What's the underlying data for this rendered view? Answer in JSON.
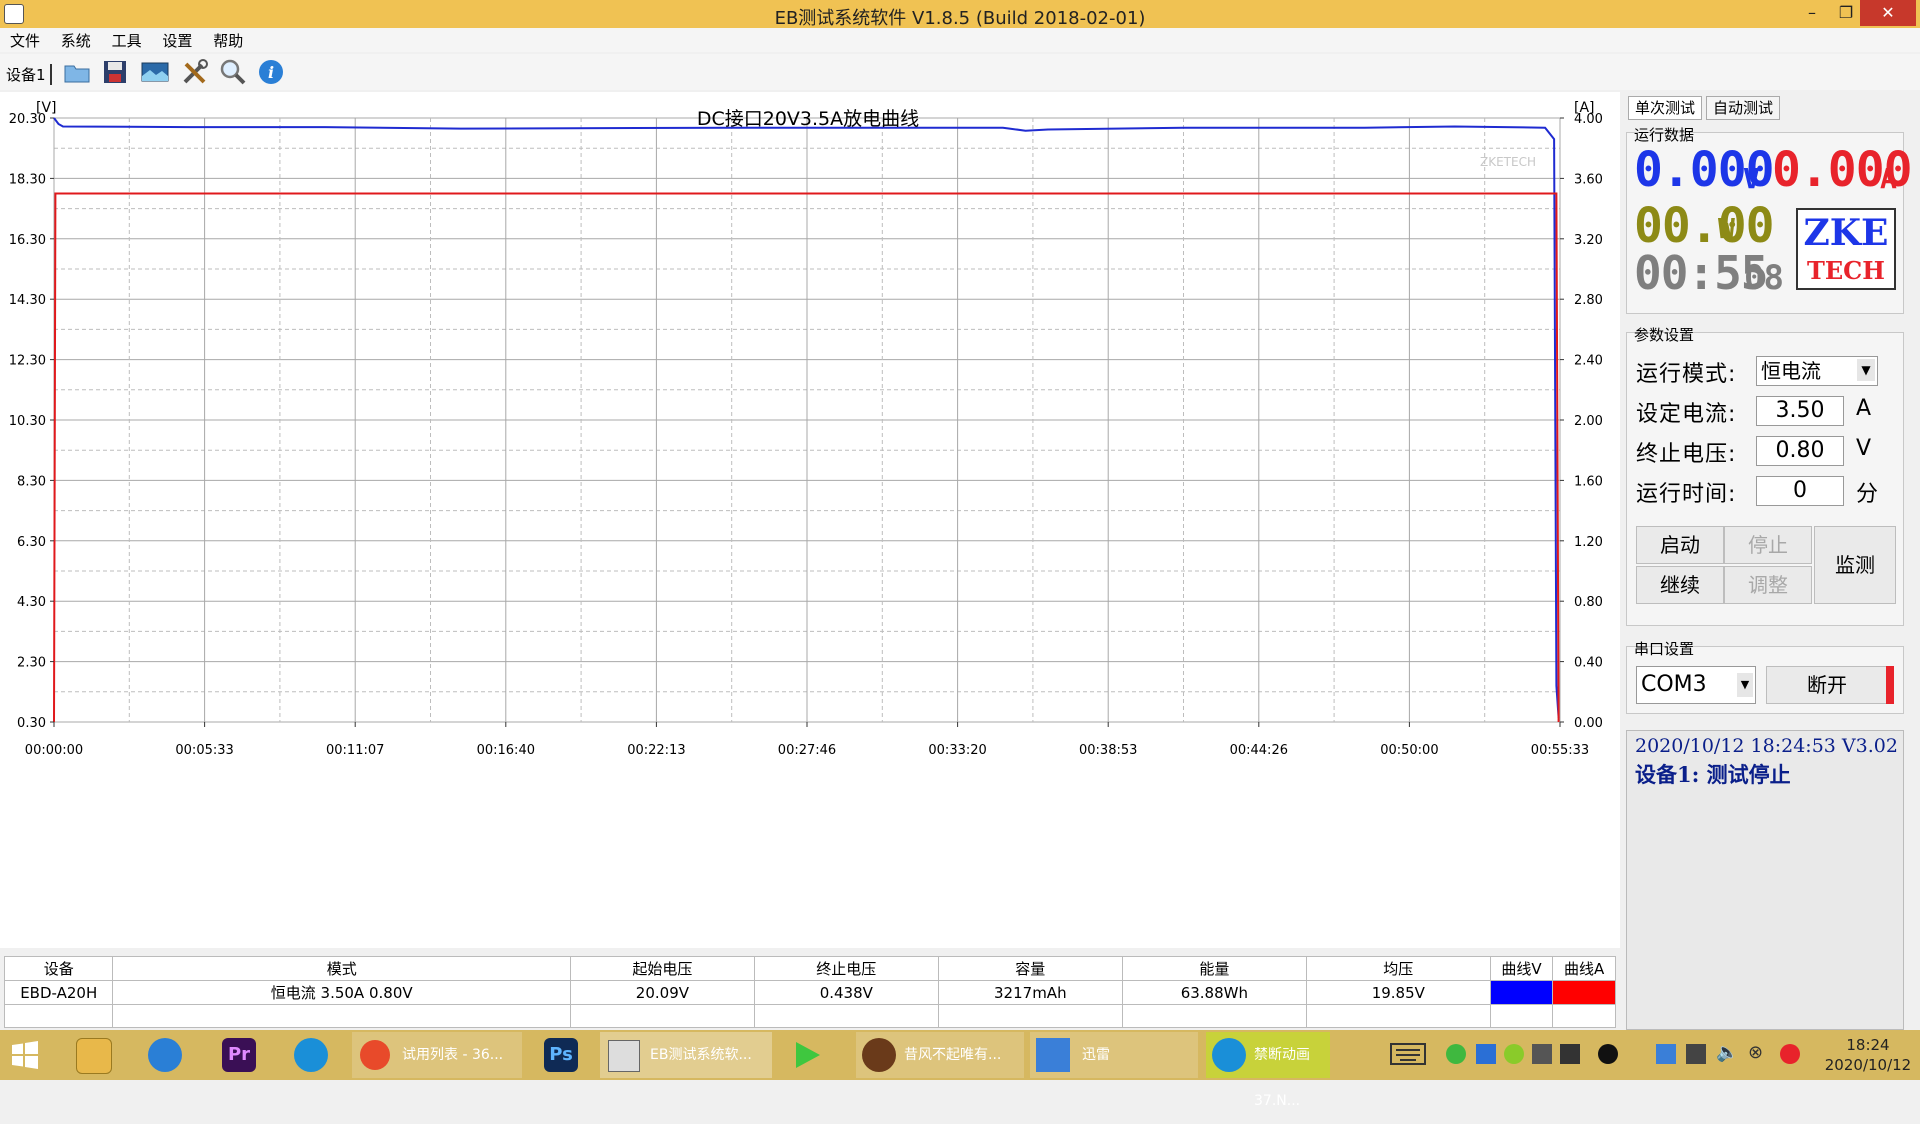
{
  "window": {
    "title": "EB测试系统软件 V1.8.5 (Build 2018-02-01)",
    "minimize": "–",
    "restore": "❐",
    "close": "✕"
  },
  "menu": [
    "文件",
    "系统",
    "工具",
    "设置",
    "帮助"
  ],
  "toolbar": {
    "device_tab": "设备1",
    "buttons": [
      "open-folder-icon",
      "save-icon",
      "image-icon",
      "tools-icon",
      "search-icon",
      "info-icon"
    ]
  },
  "chart_data": {
    "type": "line",
    "title": "DC接口20V3.5A放电曲线",
    "left_unit": "[V]",
    "right_unit": "[A]",
    "watermark": "ZKETECH",
    "x_ticks": [
      "00:00:00",
      "00:05:33",
      "00:11:07",
      "00:16:40",
      "00:22:13",
      "00:27:46",
      "00:33:20",
      "00:38:53",
      "00:44:26",
      "00:50:00",
      "00:55:33"
    ],
    "y_left_ticks": [
      "20.30",
      "18.30",
      "16.30",
      "14.30",
      "12.30",
      "10.30",
      "8.30",
      "6.30",
      "4.30",
      "2.30",
      "0.30"
    ],
    "y_right_ticks": [
      "4.00",
      "3.60",
      "3.20",
      "2.80",
      "2.40",
      "2.00",
      "1.60",
      "1.20",
      "0.80",
      "0.40",
      "0.00"
    ],
    "y_left_range": [
      0.3,
      20.3
    ],
    "y_right_range": [
      0.0,
      4.0
    ],
    "x_range_seconds": [
      0,
      3333
    ],
    "grid": true,
    "series": [
      {
        "axis": "left",
        "color": "#1f2bd1",
        "points": [
          [
            0,
            20.3
          ],
          [
            10,
            20.1
          ],
          [
            20,
            20.02
          ],
          [
            300,
            20.0
          ],
          [
            600,
            20.0
          ],
          [
            900,
            19.95
          ],
          [
            1500,
            19.98
          ],
          [
            2100,
            19.98
          ],
          [
            2150,
            19.88
          ],
          [
            2200,
            19.92
          ],
          [
            2500,
            19.98
          ],
          [
            2900,
            19.98
          ],
          [
            3100,
            20.02
          ],
          [
            3300,
            19.98
          ],
          [
            3320,
            19.6
          ],
          [
            3325,
            1.5
          ],
          [
            3330,
            0.44
          ]
        ]
      },
      {
        "axis": "right",
        "color": "#e0191c",
        "points": [
          [
            0,
            0.0
          ],
          [
            3,
            3.5
          ],
          [
            3325,
            3.5
          ],
          [
            3330,
            0.0
          ]
        ]
      }
    ]
  },
  "panel": {
    "tabs": [
      "单次测试",
      "自动测试"
    ],
    "run_data_label": "运行数据",
    "voltage": "0.000",
    "voltage_unit": "V",
    "current": "0.000",
    "current_unit": "A",
    "power": "00.00",
    "power_unit": "W",
    "time": "00:55",
    "time_sec": "08",
    "logo_top": "ZKE",
    "logo_bottom": "TECH",
    "params_label": "参数设置",
    "mode_label": "运行模式:",
    "mode_value": "恒电流",
    "current_set_label": "设定电流:",
    "current_set_value": "3.50",
    "current_set_unit": "A",
    "cutoff_label": "终止电压:",
    "cutoff_value": "0.80",
    "cutoff_unit": "V",
    "runtime_label": "运行时间:",
    "runtime_value": "0",
    "runtime_unit": "分",
    "btn_start": "启动",
    "btn_stop": "停止",
    "btn_continue": "继续",
    "btn_adjust": "调整",
    "btn_monitor": "监测",
    "serial_label": "串口设置",
    "com_value": "COM3",
    "disconnect": "断开",
    "log_line1": "2020/10/12 18:24:53  V3.02",
    "log_line2": "设备1: 测试停止"
  },
  "table": {
    "headers": [
      "设备",
      "模式",
      "起始电压",
      "终止电压",
      "容量",
      "能量",
      "均压",
      "曲线V",
      "曲线A"
    ],
    "row": [
      "EBD-A20H",
      "恒电流  3.50A  0.80V",
      "20.09V",
      "0.438V",
      "3217mAh",
      "63.88Wh",
      "19.85V",
      "",
      ""
    ],
    "curve_v_color": "#0000ff",
    "curve_a_color": "#ff0000"
  },
  "taskbar": {
    "tasks": [
      "试用列表 - 36...",
      "EB测试系统软...",
      "昔风不起唯有...",
      "迅雷",
      "禁断动画37.N..."
    ],
    "clock_time": "18:24",
    "clock_date": "2020/10/12"
  }
}
